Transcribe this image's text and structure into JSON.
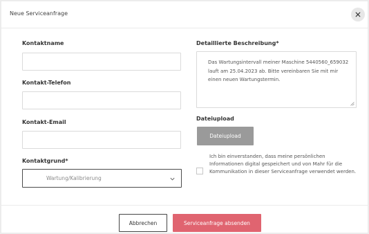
{
  "modal": {
    "title": "Neue Serviceanfrage",
    "close_icon": "close-icon"
  },
  "form": {
    "contact_name": {
      "label": "Kontaktname",
      "value": ""
    },
    "contact_phone": {
      "label": "Kontakt-Telefon",
      "value": ""
    },
    "contact_email": {
      "label": "Kontakt-Email",
      "value": ""
    },
    "contact_reason": {
      "label": "Kontaktgrund*",
      "selected": "Wartung/Kalibrierung",
      "icon": "chevron-down-icon"
    },
    "description": {
      "label": "Detaillierte Beschreibung*",
      "value": "Das Wartungsintervall meiner Maschine 5440560_659032 lauft am 25.04.2023 ab. Bitte vereinbaren Sie mit mir einen neuen Wartungstermin."
    },
    "upload": {
      "label": "Dateiupload",
      "button_label": "Dateiupload"
    },
    "consent": {
      "checked": false,
      "text": "Ich bin einverstanden, dass meine persönlichen Informationen digital gespeichert und von Mahr für die Kommunikation in dieser Serviceanfrage verwendet werden."
    }
  },
  "footer": {
    "cancel_label": "Abbrechen",
    "submit_label": "Serviceanfrage absenden"
  },
  "colors": {
    "accent": "#e06470",
    "upload_button": "#9a9a9a"
  }
}
